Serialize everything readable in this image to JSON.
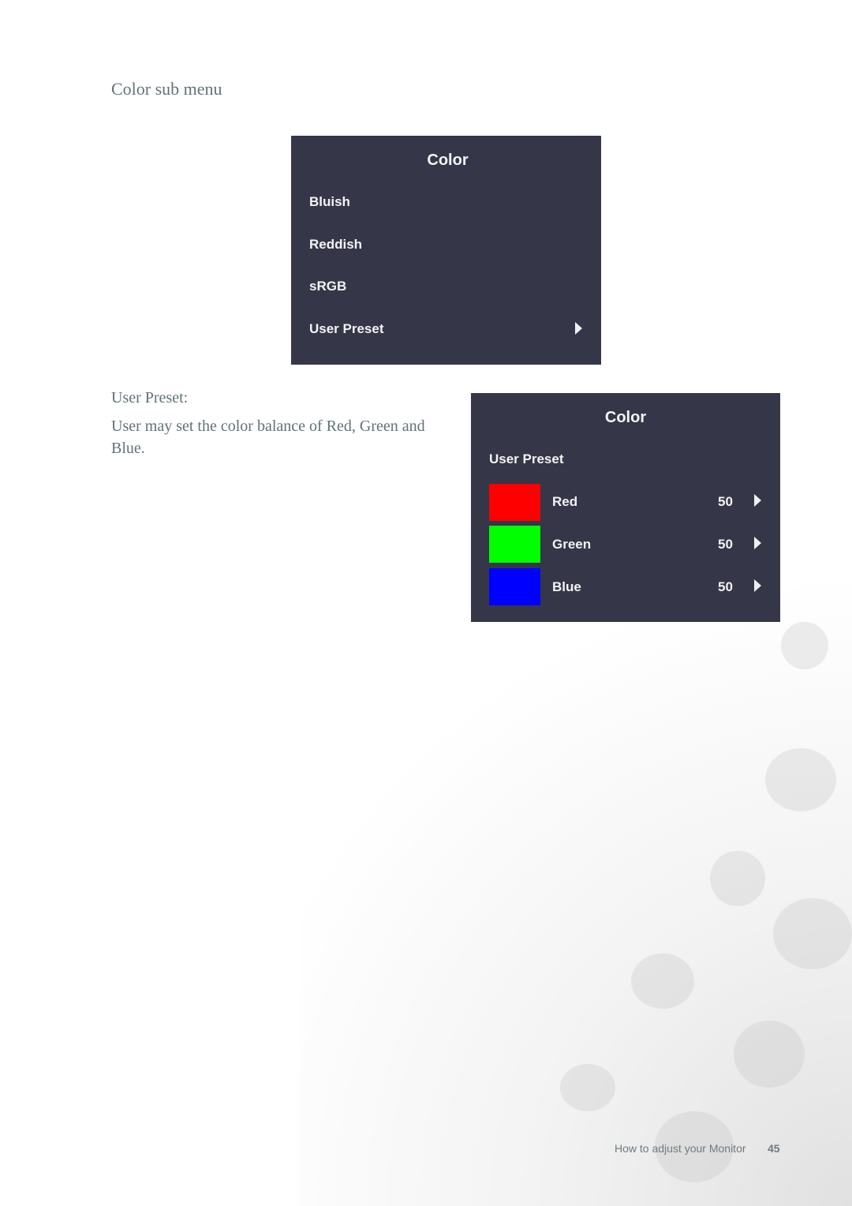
{
  "section": {
    "title": "Color sub menu"
  },
  "osd_color_menu": {
    "title": "Color",
    "items": [
      {
        "label": "Bluish"
      },
      {
        "label": "Reddish"
      },
      {
        "label": "sRGB"
      },
      {
        "label": "User Preset",
        "has_submenu": true,
        "icon": "arrow-right-icon"
      }
    ]
  },
  "description": {
    "heading": "User Preset:",
    "text": "User may set the color balance of Red, Green and Blue."
  },
  "osd_user_preset": {
    "title": "Color",
    "subtitle": "User Preset",
    "channels": [
      {
        "label": "Red",
        "value": "50",
        "swatch_color": "#ff0000",
        "icon": "arrow-right-icon"
      },
      {
        "label": "Green",
        "value": "50",
        "swatch_color": "#00ff00",
        "icon": "arrow-right-icon"
      },
      {
        "label": "Blue",
        "value": "50",
        "swatch_color": "#0000ff",
        "icon": "arrow-right-icon"
      }
    ]
  },
  "footer": {
    "text": "How to adjust your Monitor",
    "page_number": "45"
  },
  "colors": {
    "osd_background": "#363649",
    "body_text": "#5f7378"
  }
}
